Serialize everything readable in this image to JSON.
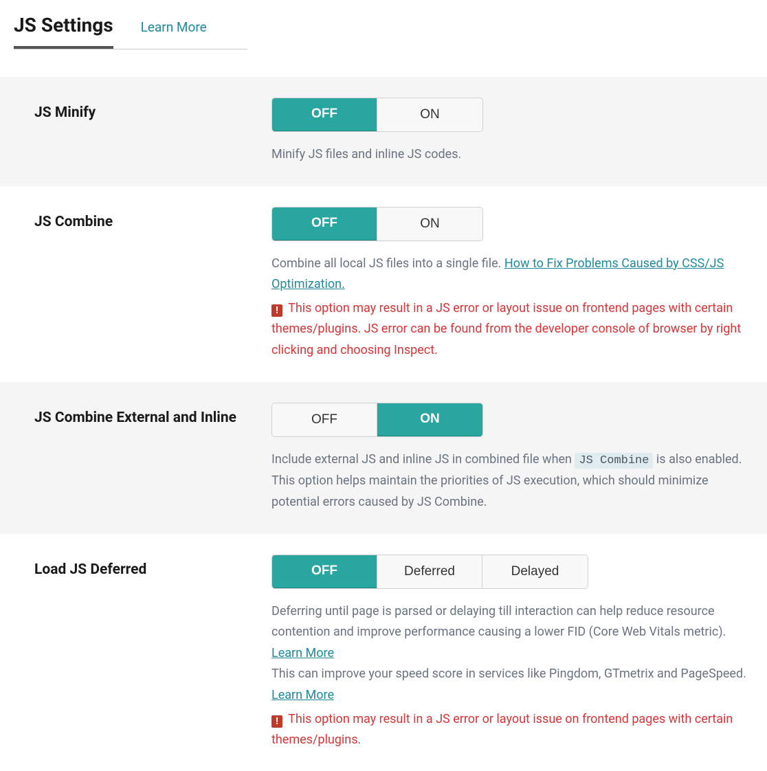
{
  "tabs": {
    "active": "JS Settings",
    "link": "Learn More"
  },
  "toggle_labels": {
    "off": "OFF",
    "on": "ON",
    "deferred": "Deferred",
    "delayed": "Delayed"
  },
  "settings": {
    "js_minify": {
      "label": "JS Minify",
      "desc": "Minify JS files and inline JS codes."
    },
    "js_combine": {
      "label": "JS Combine",
      "desc_pre": "Combine all local JS files into a single file. ",
      "link": "How to Fix Problems Caused by CSS/JS Optimization.",
      "warning": "This option may result in a JS error or layout issue on frontend pages with certain themes/plugins. JS error can be found from the developer console of browser by right clicking and choosing Inspect."
    },
    "js_combine_ext": {
      "label": "JS Combine External and Inline",
      "desc_pre": "Include external JS and inline JS in combined file when ",
      "code": "JS Combine",
      "desc_post": " is also enabled. This option helps maintain the priorities of JS execution, which should minimize potential errors caused by JS Combine."
    },
    "js_deferred": {
      "label": "Load JS Deferred",
      "desc1_pre": "Deferring until page is parsed or delaying till interaction can help reduce resource contention and improve performance causing a lower FID (Core Web Vitals metric). ",
      "link1": "Learn More",
      "desc2_pre": "This can improve your speed score in services like Pingdom, GTmetrix and PageSpeed. ",
      "link2": "Learn More",
      "warning": "This option may result in a JS error or layout issue on frontend pages with certain themes/plugins."
    }
  }
}
